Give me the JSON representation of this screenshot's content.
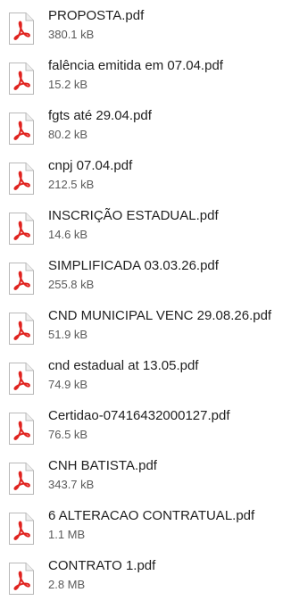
{
  "colors": {
    "pdf_accent": "#e0231f",
    "text_primary": "#1f1f1f",
    "text_secondary": "#5a5a5a"
  },
  "files": [
    {
      "name": "PROPOSTA.pdf",
      "size": "380.1 kB",
      "icon": "pdf-file-icon"
    },
    {
      "name": "falência emitida em 07.04.pdf",
      "size": "15.2 kB",
      "icon": "pdf-file-icon"
    },
    {
      "name": "fgts até 29.04.pdf",
      "size": "80.2 kB",
      "icon": "pdf-file-icon"
    },
    {
      "name": "cnpj 07.04.pdf",
      "size": "212.5 kB",
      "icon": "pdf-file-icon"
    },
    {
      "name": "INSCRIÇÃO ESTADUAL.pdf",
      "size": "14.6 kB",
      "icon": "pdf-file-icon"
    },
    {
      "name": "SIMPLIFICADA 03.03.26.pdf",
      "size": "255.8 kB",
      "icon": "pdf-file-icon"
    },
    {
      "name": "CND MUNICIPAL VENC 29.08.26.pdf",
      "size": "51.9 kB",
      "icon": "pdf-file-icon"
    },
    {
      "name": "cnd estadual at 13.05.pdf",
      "size": "74.9 kB",
      "icon": "pdf-file-icon"
    },
    {
      "name": "Certidao-07416432000127.pdf",
      "size": "76.5 kB",
      "icon": "pdf-file-icon"
    },
    {
      "name": "CNH BATISTA.pdf",
      "size": "343.7 kB",
      "icon": "pdf-file-icon"
    },
    {
      "name": "6 ALTERACAO CONTRATUAL.pdf",
      "size": "1.1 MB",
      "icon": "pdf-file-icon"
    },
    {
      "name": "CONTRATO 1.pdf",
      "size": "2.8 MB",
      "icon": "pdf-file-icon"
    }
  ]
}
